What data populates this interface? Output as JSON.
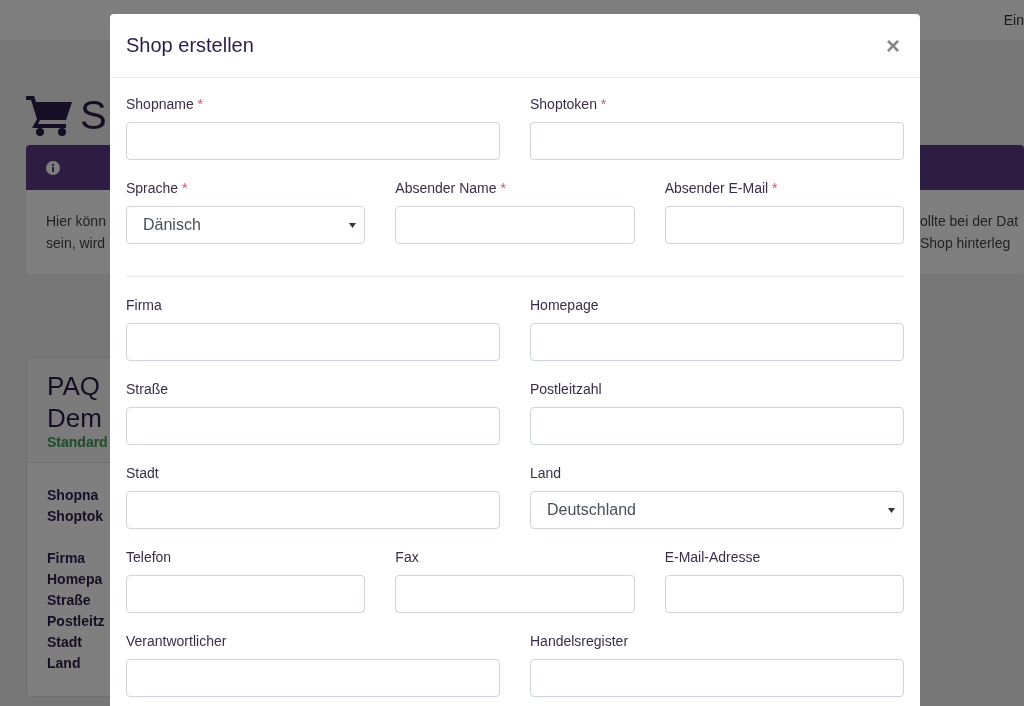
{
  "background": {
    "top_right_text": "Ein",
    "heading": "S",
    "info_text_left": [
      "Hier könn",
      "sein, wird"
    ],
    "info_text_right": [
      "ollte bei der Dat",
      "Shop hinterleg"
    ],
    "shop_card": {
      "title_lines": [
        "PAQ",
        "Dem"
      ],
      "badge": "Standard",
      "label_groups": [
        [
          "Shopna",
          "Shoptok"
        ],
        [
          "Firma",
          "Homepa",
          "Straße",
          "Postleitz",
          "Stadt",
          "Land"
        ]
      ]
    }
  },
  "modal": {
    "title": "Shop erstellen",
    "close": "×",
    "sections": [
      {
        "rows": [
          [
            {
              "label": "Shopname",
              "required_mark": "*",
              "kind": "text"
            },
            {
              "label": "Shoptoken",
              "required_mark": "*",
              "kind": "text"
            }
          ],
          [
            {
              "label": "Sprache",
              "required_mark": "*",
              "kind": "select",
              "value": "Dänisch"
            },
            {
              "label": "Absender Name",
              "required_mark": "*",
              "kind": "text"
            },
            {
              "label": "Absender E-Mail",
              "required_mark": "*",
              "kind": "text"
            }
          ]
        ]
      },
      {
        "rows": [
          [
            {
              "label": "Firma",
              "kind": "text"
            },
            {
              "label": "Homepage",
              "kind": "text"
            }
          ],
          [
            {
              "label": "Straße",
              "kind": "text"
            },
            {
              "label": "Postleitzahl",
              "kind": "text"
            }
          ],
          [
            {
              "label": "Stadt",
              "kind": "text"
            },
            {
              "label": "Land",
              "kind": "select",
              "value": "Deutschland"
            }
          ],
          [
            {
              "label": "Telefon",
              "kind": "text"
            },
            {
              "label": "Fax",
              "kind": "text"
            },
            {
              "label": "E-Mail-Adresse",
              "kind": "text"
            }
          ],
          [
            {
              "label": "Verantwortlicher",
              "kind": "text"
            },
            {
              "label": "Handelsregister",
              "kind": "text"
            }
          ]
        ]
      }
    ]
  }
}
